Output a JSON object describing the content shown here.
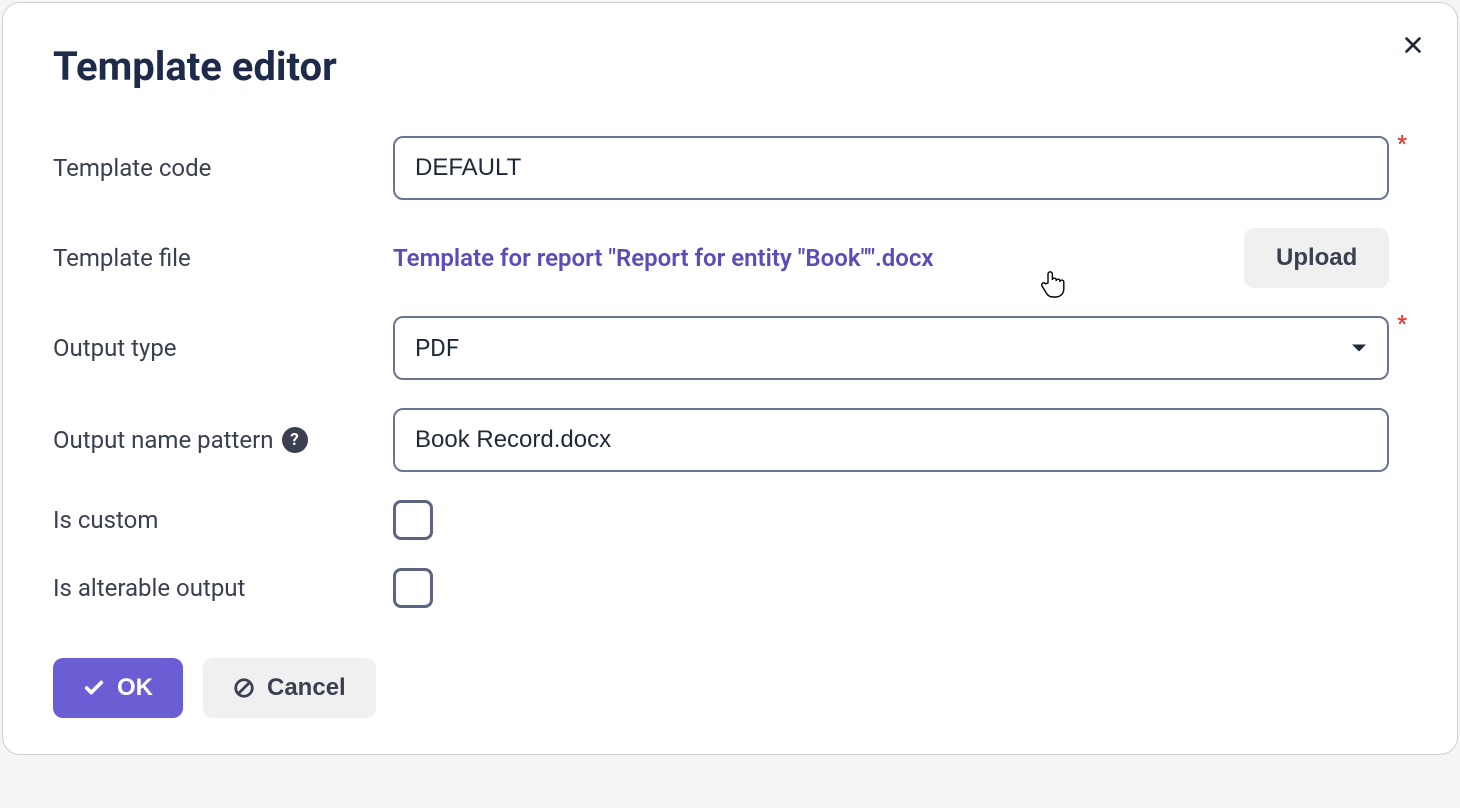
{
  "dialog": {
    "title": "Template editor"
  },
  "fields": {
    "template_code": {
      "label": "Template code",
      "value": "DEFAULT"
    },
    "template_file": {
      "label": "Template file",
      "filename": "Template for report \"Report for entity \"Book\"\".docx",
      "upload_label": "Upload"
    },
    "output_type": {
      "label": "Output type",
      "value": "PDF"
    },
    "output_name_pattern": {
      "label": "Output name pattern",
      "value": "Book Record.docx"
    },
    "is_custom": {
      "label": "Is custom",
      "checked": false
    },
    "is_alterable": {
      "label": "Is alterable output",
      "checked": false
    }
  },
  "buttons": {
    "ok": "OK",
    "cancel": "Cancel"
  },
  "help_tooltip": "?"
}
